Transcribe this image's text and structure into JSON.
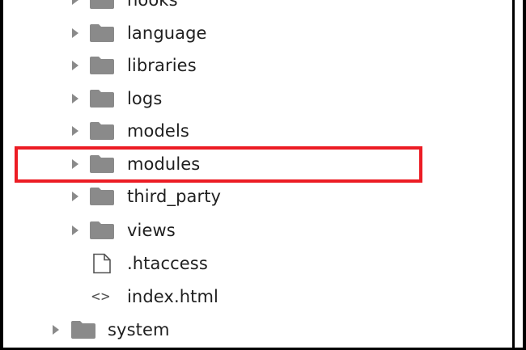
{
  "tree": {
    "items": [
      {
        "label": "hooks",
        "type": "folder"
      },
      {
        "label": "language",
        "type": "folder"
      },
      {
        "label": "libraries",
        "type": "folder"
      },
      {
        "label": "logs",
        "type": "folder"
      },
      {
        "label": "models",
        "type": "folder"
      },
      {
        "label": "modules",
        "type": "folder",
        "highlighted": true
      },
      {
        "label": "third_party",
        "type": "folder"
      },
      {
        "label": "views",
        "type": "folder"
      },
      {
        "label": ".htaccess",
        "type": "file",
        "icon": "file-icon"
      },
      {
        "label": "index.html",
        "type": "file",
        "icon": "code-icon"
      },
      {
        "label": "system",
        "type": "folder"
      }
    ]
  },
  "colors": {
    "highlight": "#ec1c24",
    "folder_icon": "#8a8a8a",
    "arrow_icon": "#8a8a8a",
    "text": "#1f1f1f"
  },
  "icons": {
    "expand": "chevron-right-icon",
    "folder": "folder-icon",
    "file": "file-icon",
    "code": "code-icon"
  },
  "code_icon_glyph": "<>"
}
